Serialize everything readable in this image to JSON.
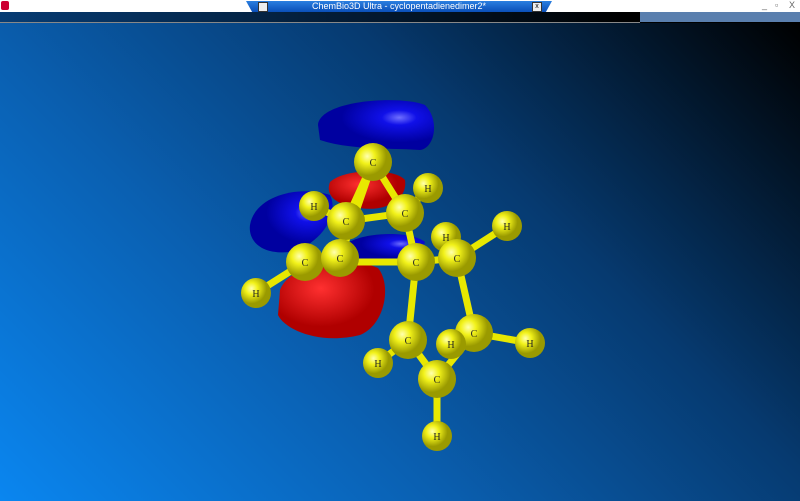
{
  "window": {
    "title": "ChemBio3D Ultra - cyclopentadienedimer2*",
    "close": "x",
    "min": "_",
    "max": "▫",
    "exit": "X"
  },
  "molecule": {
    "atoms": [
      "C",
      "H",
      "H",
      "C",
      "C",
      "H",
      "H",
      "C",
      "C",
      "C",
      "C",
      "H",
      "C",
      "C",
      "H",
      "H",
      "H",
      "C",
      "H"
    ],
    "atom_color": "#f2f21a",
    "orbital_positive": "#e60000",
    "orbital_negative": "#0000e0"
  }
}
